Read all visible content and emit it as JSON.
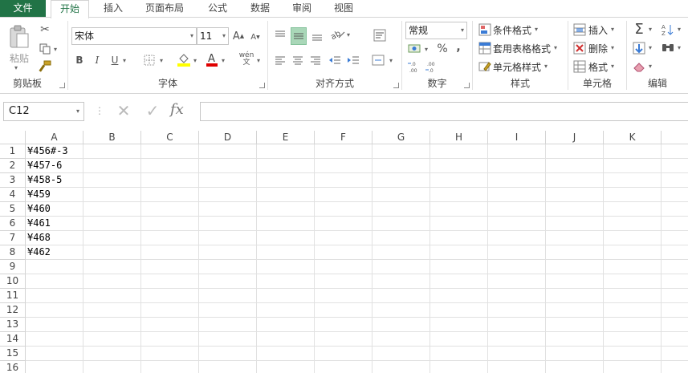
{
  "tabs": [
    "文件",
    "开始",
    "插入",
    "页面布局",
    "公式",
    "数据",
    "审阅",
    "视图"
  ],
  "ribbon": {
    "clipboard": {
      "label": "剪贴板",
      "paste": "粘贴"
    },
    "font": {
      "label": "字体",
      "name": "宋体",
      "size": "11",
      "bold": "B",
      "italic": "I",
      "underline": "U",
      "wen": "wén",
      "wen_sub": "文"
    },
    "align": {
      "label": "对齐方式"
    },
    "number": {
      "label": "数字",
      "format": "常规",
      "percent": "%",
      "comma": ","
    },
    "styles": {
      "label": "样式",
      "cond": "条件格式",
      "table": "套用表格格式",
      "cell": "单元格样式"
    },
    "cells": {
      "label": "单元格",
      "insert": "插入",
      "delete": "删除",
      "format": "格式"
    },
    "edit": {
      "label": "编辑"
    }
  },
  "formula_bar": {
    "name_box": "C12",
    "fx": "fx",
    "value": ""
  },
  "sheet": {
    "columns": [
      "A",
      "B",
      "C",
      "D",
      "E",
      "F",
      "G",
      "H",
      "I",
      "J",
      "K"
    ],
    "rows": [
      "1",
      "2",
      "3",
      "4",
      "5",
      "6",
      "7",
      "8",
      "9",
      "10",
      "11",
      "12",
      "13",
      "14",
      "15",
      "16"
    ],
    "colA": [
      "¥456#-3",
      "¥457-6",
      "¥458-5",
      "¥459",
      "¥460",
      "¥461",
      "¥468",
      "¥462"
    ]
  }
}
